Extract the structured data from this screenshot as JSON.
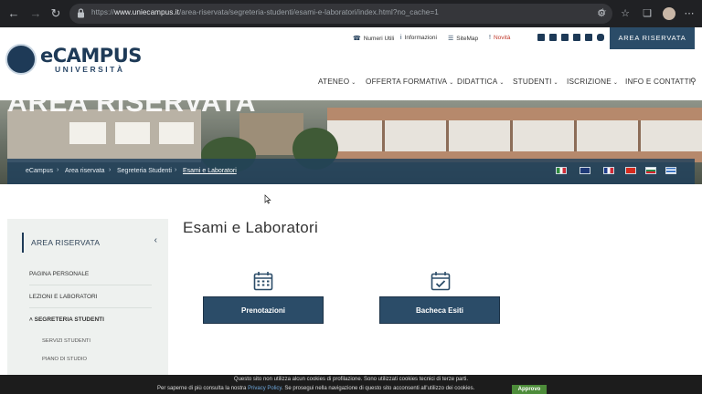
{
  "browser": {
    "url_scheme": "https://",
    "url_host": "www.uniecampus.it",
    "url_path": "/area-riservata/segreteria-studenti/esami-e-laboratori/index.html?no_cache=1"
  },
  "header": {
    "logo_text": "eCAMPUS",
    "logo_sub": "UNIVERSITÀ",
    "topbar": [
      "Numeri Utili",
      "Informazioni",
      "SiteMap",
      "Novità"
    ],
    "area_button": "AREA RISERVATA",
    "menu": [
      "ATENEO",
      "OFFERTA FORMATIVA",
      "DIDATTICA",
      "STUDENTI",
      "ISCRIZIONE",
      "INFO E CONTATTI"
    ]
  },
  "hero": {
    "title": "AREA RISERVATA",
    "breadcrumb": [
      "eCampus",
      "Area riservata",
      "Segreteria Studenti",
      "Esami e Laboratori"
    ],
    "flags": [
      "flag-italy",
      "flag-uk",
      "flag-france",
      "flag-turkey",
      "flag-bulgaria",
      "flag-greece"
    ]
  },
  "sidebar": {
    "title": "AREA RISERVATA",
    "items": [
      "PAGINA PERSONALE",
      "LEZIONI E LABORATORI",
      "SEGRETERIA STUDENTI"
    ],
    "subitems": [
      "SERVIZI STUDENTI",
      "PIANO DI STUDIO"
    ]
  },
  "main": {
    "title": "Esami e Laboratori",
    "cards": [
      {
        "label": "Prenotazioni",
        "icon": "calendar-icon"
      },
      {
        "label": "Bacheca Esiti",
        "icon": "calendar-check-icon"
      }
    ]
  },
  "cookie": {
    "line1": "Questo sito non utilizza alcun cookies di profilazione. Sono utilizzati cookies tecnici di terze parti.",
    "line2_a": "Per saperne di più consulta la nostra",
    "policy_link": "Privacy Policy",
    "line2_b": ". Se prosegui nella navigazione di questo sito acconsenti all'utilizzo dei cookies.",
    "approve": "Approvo"
  },
  "colors": {
    "brand_blue": "#2b4c68",
    "chrome_dark": "#202124",
    "cookie_green": "#4d8c3a"
  }
}
